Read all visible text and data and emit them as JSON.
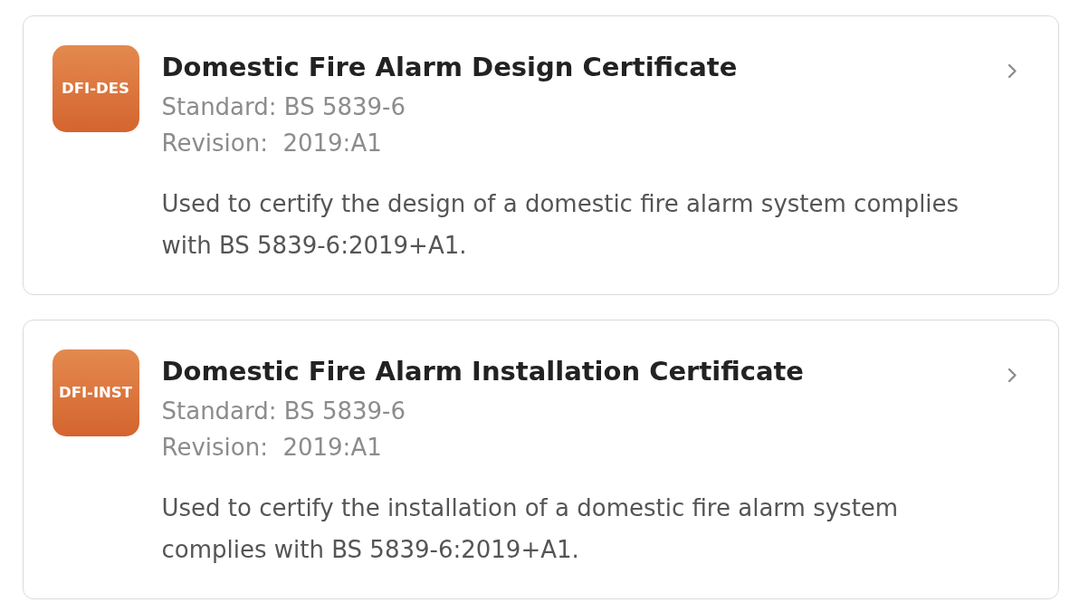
{
  "certificates": [
    {
      "code": "DFI-DES",
      "title": "Domestic Fire Alarm Design Certificate",
      "standard": "Standard: BS 5839-6",
      "revision": "Revision:  2019:A1",
      "description": "Used to certify the design of a domestic fire alarm system complies with BS 5839-6:2019+A1."
    },
    {
      "code": "DFI-INST",
      "title": "Domestic Fire Alarm Installation Certificate",
      "standard": "Standard: BS 5839-6",
      "revision": "Revision:  2019:A1",
      "description": "Used to certify the installation of a domestic fire alarm system complies with BS 5839-6:2019+A1."
    }
  ]
}
